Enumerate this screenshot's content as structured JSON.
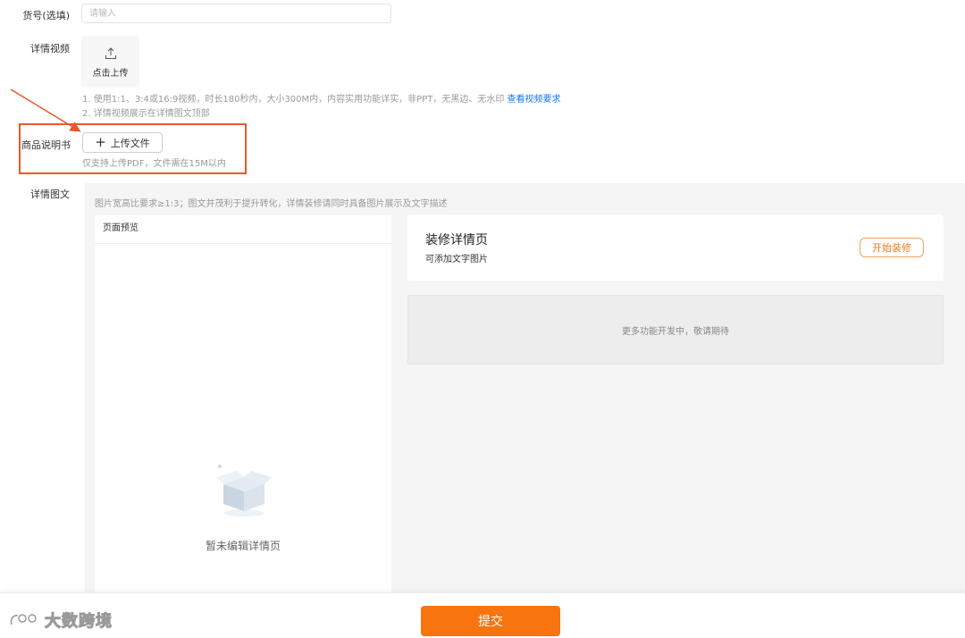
{
  "form": {
    "item_no": {
      "label": "货号(选填)",
      "placeholder": "请输入"
    },
    "video": {
      "label": "详情视频",
      "upload_label": "点击上传",
      "hint_line1": "1. 使用1:1、3:4或16:9视频，时长180秒内，大小300M内，内容实用功能详实，非PPT，无黑边、无水印",
      "hint_link": "查看视频要求",
      "hint_line2": "2. 详情视频展示在详情图文顶部"
    },
    "manual": {
      "label": "商品说明书",
      "upload_button": "上传文件",
      "hint": "仅支持上传PDF，文件需在15M以内"
    },
    "detail": {
      "label": "详情图文",
      "hint": "图片宽高比要求≥1:3；图文并茂利于提升转化，详情装修请同时具备图片展示及文字描述",
      "preview_title": "页面预览",
      "empty_text": "暂未编辑详情页",
      "decor_title": "装修详情页",
      "decor_subtitle": "可添加文字图片",
      "start_button": "开始装修",
      "coming_soon": "更多功能开发中，敬请期待"
    }
  },
  "footer": {
    "submit_label": "提交",
    "brand": "大数跨境"
  },
  "colors": {
    "accent": "#f7740f",
    "highlight": "#e8592a",
    "link": "#1677ff"
  }
}
